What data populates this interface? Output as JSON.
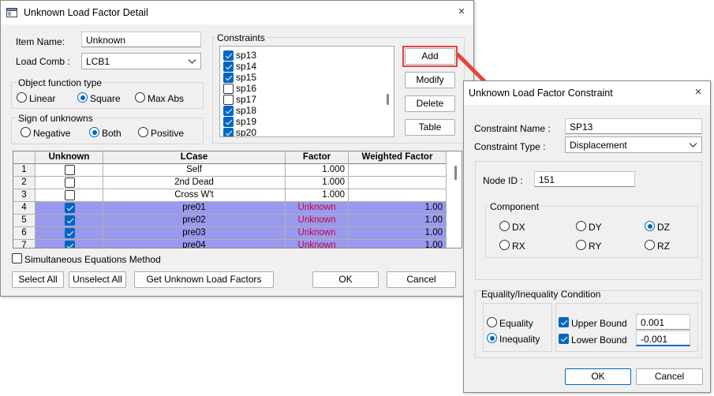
{
  "main_dialog": {
    "title": "Unknown Load Factor Detail",
    "close_glyph": "×",
    "item_name_label": "Item Name:",
    "item_name_value": "Unknown",
    "load_comb_label": "Load Comb :",
    "load_comb_value": "LCB1",
    "object_function": {
      "label": "Object function type",
      "options": [
        "Linear",
        "Square",
        "Max Abs"
      ],
      "selected": "Square"
    },
    "sign_of_unknowns": {
      "label": "Sign of unknowns",
      "options": [
        "Negative",
        "Both",
        "Positive"
      ],
      "selected": "Both"
    },
    "constraints": {
      "label": "Constraints",
      "items": [
        {
          "name": "sp13",
          "checked": true
        },
        {
          "name": "sp14",
          "checked": true
        },
        {
          "name": "sp15",
          "checked": true
        },
        {
          "name": "sp16",
          "checked": false
        },
        {
          "name": "sp17",
          "checked": false
        },
        {
          "name": "sp18",
          "checked": true
        },
        {
          "name": "sp19",
          "checked": true
        },
        {
          "name": "sp20",
          "checked": true
        }
      ]
    },
    "side_buttons": {
      "add": "Add",
      "modify": "Modify",
      "delete": "Delete",
      "table": "Table"
    },
    "grid": {
      "headers": [
        "",
        "Unknown",
        "LCase",
        "Factor",
        "Weighted Factor"
      ],
      "rows": [
        {
          "num": "1",
          "unknown": false,
          "lcase": "Self",
          "factor": "1.000",
          "weighted": "",
          "selected": false
        },
        {
          "num": "2",
          "unknown": false,
          "lcase": "2nd Dead",
          "factor": "1.000",
          "weighted": "",
          "selected": false
        },
        {
          "num": "3",
          "unknown": false,
          "lcase": "Cross W't",
          "factor": "1.000",
          "weighted": "",
          "selected": false
        },
        {
          "num": "4",
          "unknown": true,
          "lcase": "pre01",
          "factor": "Unknown",
          "weighted": "1.00",
          "selected": true
        },
        {
          "num": "5",
          "unknown": true,
          "lcase": "pre02",
          "factor": "Unknown",
          "weighted": "1.00",
          "selected": true
        },
        {
          "num": "6",
          "unknown": true,
          "lcase": "pre03",
          "factor": "Unknown",
          "weighted": "1.00",
          "selected": true
        },
        {
          "num": "7",
          "unknown": true,
          "lcase": "pre04",
          "factor": "Unknown",
          "weighted": "1.00",
          "selected": true
        }
      ]
    },
    "simultaneous_label": "Simultaneous Equations Method",
    "simultaneous_checked": false,
    "bottom_buttons": {
      "select_all": "Select All",
      "unselect_all": "Unselect All",
      "get_factors": "Get Unknown Load Factors",
      "ok": "OK",
      "cancel": "Cancel"
    }
  },
  "constraint_dialog": {
    "title": "Unknown Load Factor Constraint",
    "close_glyph": "×",
    "constraint_name_label": "Constraint Name :",
    "constraint_name_value": "SP13",
    "constraint_type_label": "Constraint Type :",
    "constraint_type_value": "Displacement",
    "node_id_label": "Node ID :",
    "node_id_value": "151",
    "component": {
      "label": "Component",
      "options": [
        "DX",
        "DY",
        "DZ",
        "RX",
        "RY",
        "RZ"
      ],
      "selected": "DZ"
    },
    "condition": {
      "label": "Equality/Inequality Condition",
      "options": [
        "Equality",
        "Inequality"
      ],
      "selected": "Inequality",
      "upper_bound_label": "Upper Bound",
      "upper_bound_value": "0.001",
      "upper_checked": true,
      "lower_bound_label": "Lower Bound",
      "lower_bound_value": "-0.001",
      "lower_checked": true
    },
    "ok": "OK",
    "cancel": "Cancel"
  },
  "colors": {
    "highlight_box": "#e8423f",
    "arrow": "#e8423f",
    "selected_row": "#9999ee",
    "unknown_text": "#cc0044",
    "accent": "#0067c0"
  }
}
